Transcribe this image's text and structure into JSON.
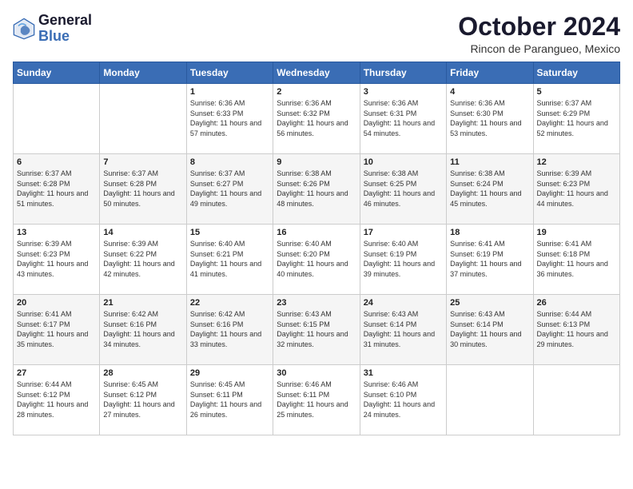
{
  "logo": {
    "line1": "General",
    "line2": "Blue"
  },
  "header": {
    "month": "October 2024",
    "location": "Rincon de Parangueo, Mexico"
  },
  "weekdays": [
    "Sunday",
    "Monday",
    "Tuesday",
    "Wednesday",
    "Thursday",
    "Friday",
    "Saturday"
  ],
  "weeks": [
    [
      {
        "day": "",
        "info": ""
      },
      {
        "day": "",
        "info": ""
      },
      {
        "day": "1",
        "info": "Sunrise: 6:36 AM\nSunset: 6:33 PM\nDaylight: 11 hours and 57 minutes."
      },
      {
        "day": "2",
        "info": "Sunrise: 6:36 AM\nSunset: 6:32 PM\nDaylight: 11 hours and 56 minutes."
      },
      {
        "day": "3",
        "info": "Sunrise: 6:36 AM\nSunset: 6:31 PM\nDaylight: 11 hours and 54 minutes."
      },
      {
        "day": "4",
        "info": "Sunrise: 6:36 AM\nSunset: 6:30 PM\nDaylight: 11 hours and 53 minutes."
      },
      {
        "day": "5",
        "info": "Sunrise: 6:37 AM\nSunset: 6:29 PM\nDaylight: 11 hours and 52 minutes."
      }
    ],
    [
      {
        "day": "6",
        "info": "Sunrise: 6:37 AM\nSunset: 6:28 PM\nDaylight: 11 hours and 51 minutes."
      },
      {
        "day": "7",
        "info": "Sunrise: 6:37 AM\nSunset: 6:28 PM\nDaylight: 11 hours and 50 minutes."
      },
      {
        "day": "8",
        "info": "Sunrise: 6:37 AM\nSunset: 6:27 PM\nDaylight: 11 hours and 49 minutes."
      },
      {
        "day": "9",
        "info": "Sunrise: 6:38 AM\nSunset: 6:26 PM\nDaylight: 11 hours and 48 minutes."
      },
      {
        "day": "10",
        "info": "Sunrise: 6:38 AM\nSunset: 6:25 PM\nDaylight: 11 hours and 46 minutes."
      },
      {
        "day": "11",
        "info": "Sunrise: 6:38 AM\nSunset: 6:24 PM\nDaylight: 11 hours and 45 minutes."
      },
      {
        "day": "12",
        "info": "Sunrise: 6:39 AM\nSunset: 6:23 PM\nDaylight: 11 hours and 44 minutes."
      }
    ],
    [
      {
        "day": "13",
        "info": "Sunrise: 6:39 AM\nSunset: 6:23 PM\nDaylight: 11 hours and 43 minutes."
      },
      {
        "day": "14",
        "info": "Sunrise: 6:39 AM\nSunset: 6:22 PM\nDaylight: 11 hours and 42 minutes."
      },
      {
        "day": "15",
        "info": "Sunrise: 6:40 AM\nSunset: 6:21 PM\nDaylight: 11 hours and 41 minutes."
      },
      {
        "day": "16",
        "info": "Sunrise: 6:40 AM\nSunset: 6:20 PM\nDaylight: 11 hours and 40 minutes."
      },
      {
        "day": "17",
        "info": "Sunrise: 6:40 AM\nSunset: 6:19 PM\nDaylight: 11 hours and 39 minutes."
      },
      {
        "day": "18",
        "info": "Sunrise: 6:41 AM\nSunset: 6:19 PM\nDaylight: 11 hours and 37 minutes."
      },
      {
        "day": "19",
        "info": "Sunrise: 6:41 AM\nSunset: 6:18 PM\nDaylight: 11 hours and 36 minutes."
      }
    ],
    [
      {
        "day": "20",
        "info": "Sunrise: 6:41 AM\nSunset: 6:17 PM\nDaylight: 11 hours and 35 minutes."
      },
      {
        "day": "21",
        "info": "Sunrise: 6:42 AM\nSunset: 6:16 PM\nDaylight: 11 hours and 34 minutes."
      },
      {
        "day": "22",
        "info": "Sunrise: 6:42 AM\nSunset: 6:16 PM\nDaylight: 11 hours and 33 minutes."
      },
      {
        "day": "23",
        "info": "Sunrise: 6:43 AM\nSunset: 6:15 PM\nDaylight: 11 hours and 32 minutes."
      },
      {
        "day": "24",
        "info": "Sunrise: 6:43 AM\nSunset: 6:14 PM\nDaylight: 11 hours and 31 minutes."
      },
      {
        "day": "25",
        "info": "Sunrise: 6:43 AM\nSunset: 6:14 PM\nDaylight: 11 hours and 30 minutes."
      },
      {
        "day": "26",
        "info": "Sunrise: 6:44 AM\nSunset: 6:13 PM\nDaylight: 11 hours and 29 minutes."
      }
    ],
    [
      {
        "day": "27",
        "info": "Sunrise: 6:44 AM\nSunset: 6:12 PM\nDaylight: 11 hours and 28 minutes."
      },
      {
        "day": "28",
        "info": "Sunrise: 6:45 AM\nSunset: 6:12 PM\nDaylight: 11 hours and 27 minutes."
      },
      {
        "day": "29",
        "info": "Sunrise: 6:45 AM\nSunset: 6:11 PM\nDaylight: 11 hours and 26 minutes."
      },
      {
        "day": "30",
        "info": "Sunrise: 6:46 AM\nSunset: 6:11 PM\nDaylight: 11 hours and 25 minutes."
      },
      {
        "day": "31",
        "info": "Sunrise: 6:46 AM\nSunset: 6:10 PM\nDaylight: 11 hours and 24 minutes."
      },
      {
        "day": "",
        "info": ""
      },
      {
        "day": "",
        "info": ""
      }
    ]
  ]
}
